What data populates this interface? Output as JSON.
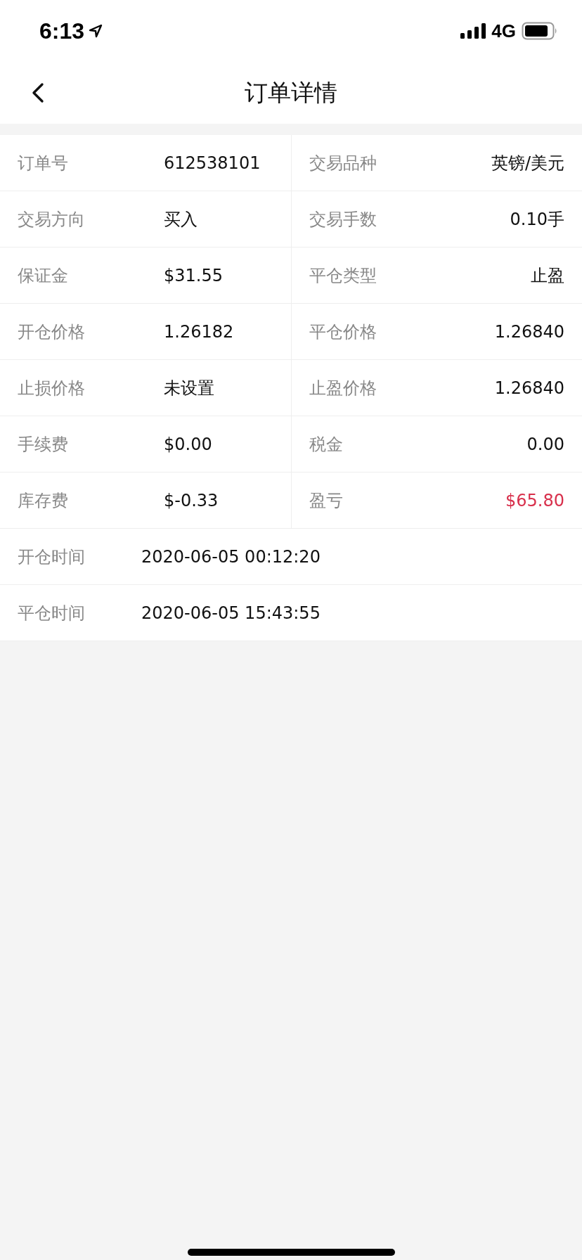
{
  "status_bar": {
    "time": "6:13",
    "network": "4G"
  },
  "nav": {
    "title": "订单详情"
  },
  "rows": [
    {
      "kind": "pair",
      "cells": [
        {
          "label": "订单号",
          "value": "612538101"
        },
        {
          "label": "交易品种",
          "value": "英镑/美元"
        }
      ]
    },
    {
      "kind": "pair",
      "cells": [
        {
          "label": "交易方向",
          "value": "买入"
        },
        {
          "label": "交易手数",
          "value": "0.10手"
        }
      ]
    },
    {
      "kind": "pair",
      "cells": [
        {
          "label": "保证金",
          "value": "$31.55"
        },
        {
          "label": "平仓类型",
          "value": "止盈"
        }
      ]
    },
    {
      "kind": "pair",
      "cells": [
        {
          "label": "开仓价格",
          "value": "1.26182"
        },
        {
          "label": "平仓价格",
          "value": "1.26840"
        }
      ]
    },
    {
      "kind": "pair",
      "cells": [
        {
          "label": "止损价格",
          "value": "未设置"
        },
        {
          "label": "止盈价格",
          "value": "1.26840"
        }
      ]
    },
    {
      "kind": "pair",
      "cells": [
        {
          "label": "手续费",
          "value": "$0.00"
        },
        {
          "label": "税金",
          "value": "0.00"
        }
      ]
    },
    {
      "kind": "pair",
      "cells": [
        {
          "label": "库存费",
          "value": "$-0.33"
        },
        {
          "label": "盈亏",
          "value": "$65.80",
          "color": "#d8304c"
        }
      ]
    },
    {
      "kind": "single",
      "cells": [
        {
          "label": "开仓时间",
          "value": "2020-06-05 00:12:20"
        }
      ]
    },
    {
      "kind": "single",
      "cells": [
        {
          "label": "平仓时间",
          "value": "2020-06-05 15:43:55"
        }
      ]
    }
  ]
}
